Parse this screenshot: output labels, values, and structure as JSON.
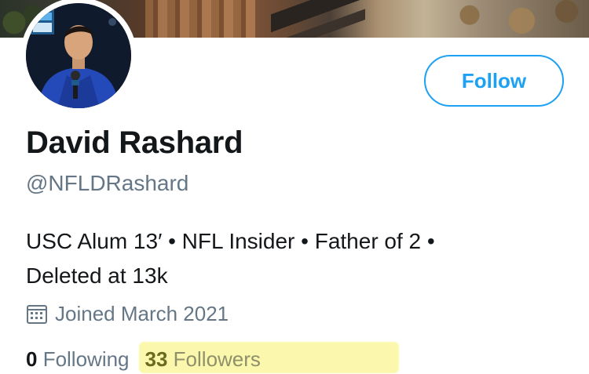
{
  "profile": {
    "name": "David Rashard",
    "handle": "@NFLDRashard",
    "bio_line1": "USC Alum 13′ • NFL Insider • Father of 2 •",
    "bio_line2": "Deleted at 13k",
    "joined": "Joined March 2021",
    "calendar_icon": "calendar-icon"
  },
  "actions": {
    "follow_label": "Follow"
  },
  "stats": {
    "following_count": "0",
    "following_label": "Following",
    "followers_count": "33",
    "followers_label": "Followers"
  },
  "colors": {
    "accent": "#1da1f2",
    "text_primary": "#14171a",
    "text_secondary": "#657786",
    "highlight": "#fbf8a6"
  }
}
